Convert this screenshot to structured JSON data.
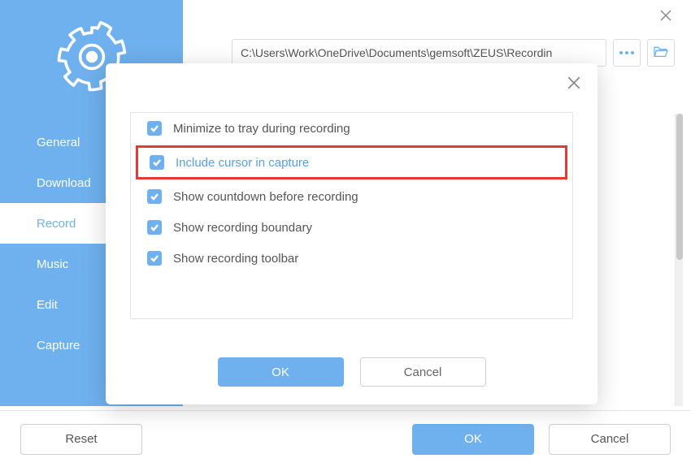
{
  "sidebar": {
    "items": [
      {
        "label": "General"
      },
      {
        "label": "Download"
      },
      {
        "label": "Record"
      },
      {
        "label": "Music"
      },
      {
        "label": "Edit"
      },
      {
        "label": "Capture"
      }
    ]
  },
  "path": {
    "value": "C:\\Users\\Work\\OneDrive\\Documents\\gemsoft\\ZEUS\\Recordin"
  },
  "modal": {
    "options": [
      {
        "label": "Minimize to tray during recording",
        "checked": true
      },
      {
        "label": "Include cursor in capture",
        "checked": true,
        "highlight": true
      },
      {
        "label": "Show countdown before recording",
        "checked": true
      },
      {
        "label": "Show recording boundary",
        "checked": true
      },
      {
        "label": "Show recording toolbar",
        "checked": true
      }
    ],
    "ok_label": "OK",
    "cancel_label": "Cancel"
  },
  "bottom": {
    "reset_label": "Reset",
    "ok_label": "OK",
    "cancel_label": "Cancel"
  }
}
